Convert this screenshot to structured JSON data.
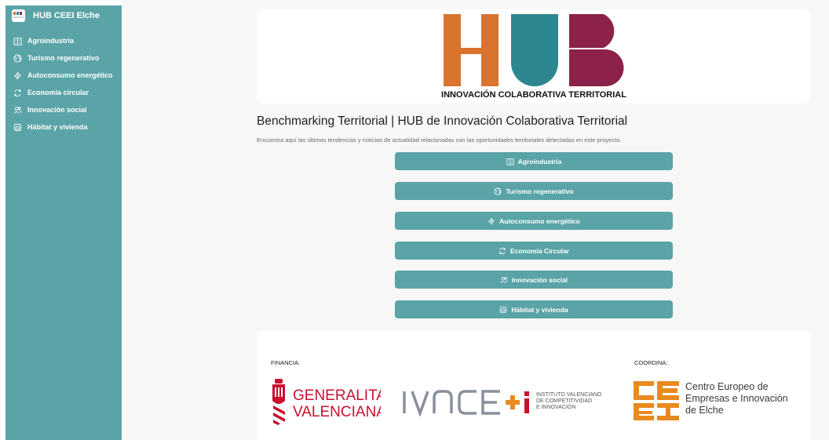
{
  "sidebar": {
    "app_title": "HUB CEEI Elche",
    "items": [
      {
        "label": "Agroindustria",
        "icon": "building-icon"
      },
      {
        "label": "Turismo regenerativo",
        "icon": "globe-icon"
      },
      {
        "label": "Autoconsumo energético",
        "icon": "lightning-icon"
      },
      {
        "label": "Economía circular",
        "icon": "refresh-icon"
      },
      {
        "label": "Innovación social",
        "icon": "users-icon"
      },
      {
        "label": "Hábitat y vivienda",
        "icon": "home-icon"
      }
    ]
  },
  "hero": {
    "logo_letters": "HUB",
    "caption": "INNOVACIÓN COLABORATIVA TERRITORIAL",
    "colors": {
      "h": "#d9732e",
      "u": "#2e8690",
      "b": "#8c2249"
    }
  },
  "main": {
    "title": "Benchmarking Territorial | HUB de Innovación Colaborativa Territorial",
    "description": "Encuentra aquí las últimas tendencias y noticias de actualidad relacionadas con las oportunidades territoriales detectadas en este proyecto.",
    "buttons": [
      {
        "label": "Agroindustria",
        "icon": "building-icon"
      },
      {
        "label": "Turismo regenerativo",
        "icon": "globe-icon"
      },
      {
        "label": "Autoconsumo energético",
        "icon": "lightning-icon"
      },
      {
        "label": "Economía Circular",
        "icon": "refresh-icon"
      },
      {
        "label": "Innovación social",
        "icon": "users-icon"
      },
      {
        "label": "Hábitat y vivienda",
        "icon": "home-icon"
      }
    ]
  },
  "footer": {
    "financia_label": "FINANCIA:",
    "coordina_label": "COORDINA:",
    "gv": {
      "line1": "GENERALITAT",
      "line2": "VALENCIANA"
    },
    "ivace": {
      "name": "IVACE+i",
      "line1": "INSTITUTO VALENCIANO",
      "line2": "DE COMPETITIVIDAD",
      "line3": "E INNOVACIÓN"
    },
    "ceei": {
      "logo_letters": "CEEI",
      "line1": "Centro Europeo de",
      "line2": "Empresas e Innovación",
      "line3": "de Elche"
    }
  },
  "colors": {
    "accent": "#5aa3a7",
    "background": "#f7f7f7",
    "gv_red": "#c8102e",
    "ceei_orange": "#e9891f"
  }
}
